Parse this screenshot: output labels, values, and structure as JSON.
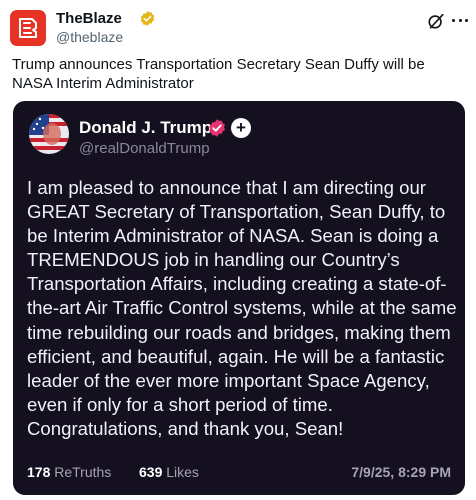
{
  "post": {
    "author_name": "TheBlaze",
    "author_handle": "@theblaze",
    "text": "Trump announces Transportation Secretary Sean Duffy will be NASA Interim Administrator",
    "icons": {
      "avatar": "theblaze-logo",
      "verified": "verified-gold-badge-icon",
      "grok": "grok-icon",
      "more": "more-icon"
    }
  },
  "embedded_card": {
    "author_name": "Donald J. Trump",
    "author_handle": "@realDonaldTrump",
    "body": "I am pleased to announce that I am directing our GREAT Secretary of Transportation, Sean Duffy, to be Interim Administrator of NASA. Sean is doing a TREMENDOUS job in handling our Country’s Transportation Affairs, including creating a state-of-the-art Air Traffic Control systems, while at the same time rebuilding our roads and bridges, making them efficient, and beautiful, again. He will be a fantastic leader of the ever more important Space Agency, even if only for a short period of time. Congratulations, and thank you, Sean!",
    "retruths_count": "178",
    "retruths_label": "ReTruths",
    "likes_count": "639",
    "likes_label": "Likes",
    "timestamp": "7/9/25, 8:29 PM",
    "follow_symbol": "+",
    "colors": {
      "background": "#14101f",
      "verified_badge": "#e4336f",
      "text": "#f2f0f6"
    }
  }
}
